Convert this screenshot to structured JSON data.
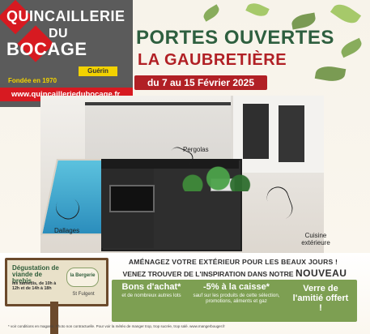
{
  "brand": {
    "name_line1": "QUINCAILLERIE",
    "name_line2": "DU",
    "name_line3": "BOCAGE",
    "subname": "Guérin",
    "founded": "Fondée en 1970",
    "url": "www.quincailleriedubocage.fr"
  },
  "event": {
    "title": "PORTES OUVERTES",
    "location": "LA GAUBRETIÈRE",
    "dates": "du 7 au 15 Février 2025"
  },
  "scene_labels": {
    "pergolas": "Pergolas",
    "dallages": "Dallages",
    "cuisine": "Cuisine extérieure"
  },
  "promo": {
    "line1": "AMÉNAGEZ VOTRE EXTÉRIEUR POUR LES BEAUX JOURS !",
    "line2": "VENEZ TROUVER DE L'INSPIRATION DANS NOTRE",
    "line2_emphasis": "NOUVEAU SHOWROOM..."
  },
  "offers": [
    {
      "title": "Bons d'achat*",
      "sub": "et de nombreux autres lots"
    },
    {
      "title": "-5% à la caisse*",
      "sub": "sauf sur les produits de cette sélection, promotions, aliments et gaz"
    },
    {
      "title": "Verre de l'amitié offert !",
      "sub": ""
    }
  ],
  "tasting": {
    "title": "Dégustation de viande de brebis",
    "schedule": "les samedis, de 10h à 12h et de 14h à 18h",
    "logo": "la Bergerie",
    "place": "St Fulgent"
  },
  "footnote": "* voir conditions en magasin. Photo non contractuelle. Pour voir la météo de manger trop, trop sucrée, trop salé. www.mangerbouger.fr"
}
